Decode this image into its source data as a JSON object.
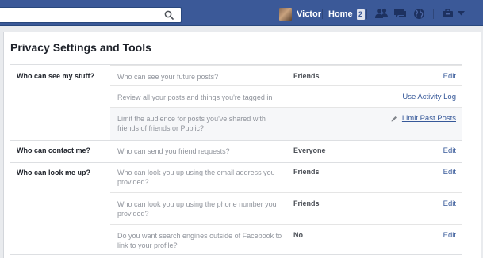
{
  "topbar": {
    "search_placeholder": "",
    "user_name": "Victor",
    "home_label": "Home",
    "home_badge": "2"
  },
  "page": {
    "title": "Privacy Settings and Tools"
  },
  "sections": {
    "stuff": {
      "label": "Who can see my stuff?",
      "rows": [
        {
          "question": "Who can see your future posts?",
          "value": "Friends",
          "action": "Edit"
        },
        {
          "question": "Review all your posts and things you're tagged in",
          "value": "",
          "action": "Use Activity Log"
        },
        {
          "question": "Limit the audience for posts you've shared with friends of friends or Public?",
          "value": "",
          "action": "Limit Past Posts"
        }
      ]
    },
    "contact": {
      "label": "Who can contact me?",
      "rows": [
        {
          "question": "Who can send you friend requests?",
          "value": "Everyone",
          "action": "Edit"
        }
      ]
    },
    "lookup": {
      "label": "Who can look me up?",
      "rows": [
        {
          "question": "Who can look you up using the email address you provided?",
          "value": "Friends",
          "action": "Edit"
        },
        {
          "question": "Who can look you up using the phone number you provided?",
          "value": "Friends",
          "action": "Edit"
        },
        {
          "question": "Do you want search engines outside of Facebook to link to your profile?",
          "value": "No",
          "action": "Edit"
        }
      ]
    }
  },
  "icons": {
    "search": "search-icon",
    "friend_requests": "friend-requests-icon",
    "messages": "messages-icon",
    "notifications": "globe-icon",
    "privacy": "privacy-shortcuts-icon",
    "account": "chevron-down-icon",
    "edit": "pencil-icon"
  },
  "colors": {
    "topbar": "#3b5998",
    "link": "#365899",
    "page_bg": "#e9ebee",
    "highlight_row": "#f6f7f9"
  }
}
